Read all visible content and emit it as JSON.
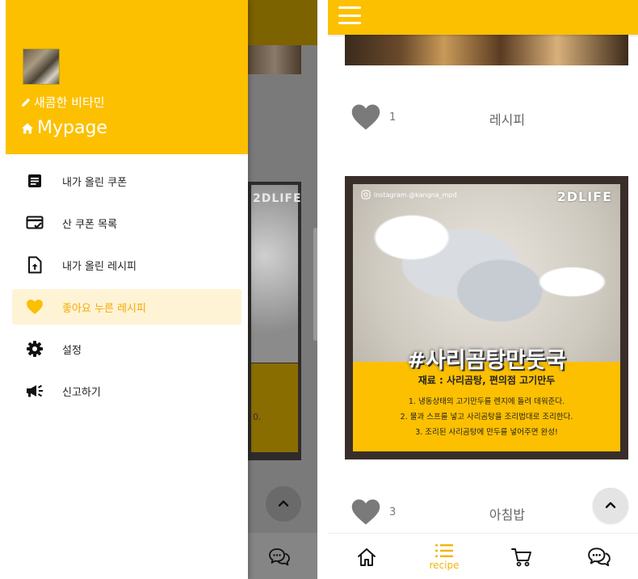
{
  "drawer": {
    "nickname": "새콤한 비타민",
    "mypage_label": "Mypage",
    "items": [
      {
        "label": "내가 올린 쿠폰",
        "icon": "document-icon"
      },
      {
        "label": "산 쿠폰 목록",
        "icon": "card-check-icon"
      },
      {
        "label": "내가 올린 레시피",
        "icon": "upload-file-icon"
      },
      {
        "label": "좋아요 누른 레시피",
        "icon": "heart-icon",
        "active": true
      },
      {
        "label": "설정",
        "icon": "gear-icon"
      },
      {
        "label": "신고하기",
        "icon": "megaphone-icon"
      }
    ]
  },
  "background": {
    "card_brand": "2DLIFE",
    "card_num": "0."
  },
  "feed": {
    "posts": [
      {
        "likes": "1",
        "title": "레시피"
      },
      {
        "likes": "3",
        "title": "아침밥"
      }
    ],
    "card": {
      "instagram_handle": "instagram.@kangna_mpd",
      "brand": "2DLIFE",
      "hashtag": "#사리곰탕만둣국",
      "ingredients": "재료 : 사리곰탕, 편의점 고기만두",
      "steps": [
        "1. 냉동상태의 고기만두를 렌지에 돌려 데워준다.",
        "2. 물과 스프를 넣고 사리곰탕을 조리법대로 조리한다.",
        "3. 조리된 사리곰탕에 만두를 넣어주면 완성!"
      ]
    }
  },
  "bottom_nav": {
    "recipe_label": "recipe",
    "items": [
      "home-icon",
      "list-icon",
      "cart-icon",
      "chat-icon"
    ]
  },
  "colors": {
    "accent": "#fcc000",
    "active_text": "#f5ab00",
    "active_bg": "#fff3d6"
  }
}
